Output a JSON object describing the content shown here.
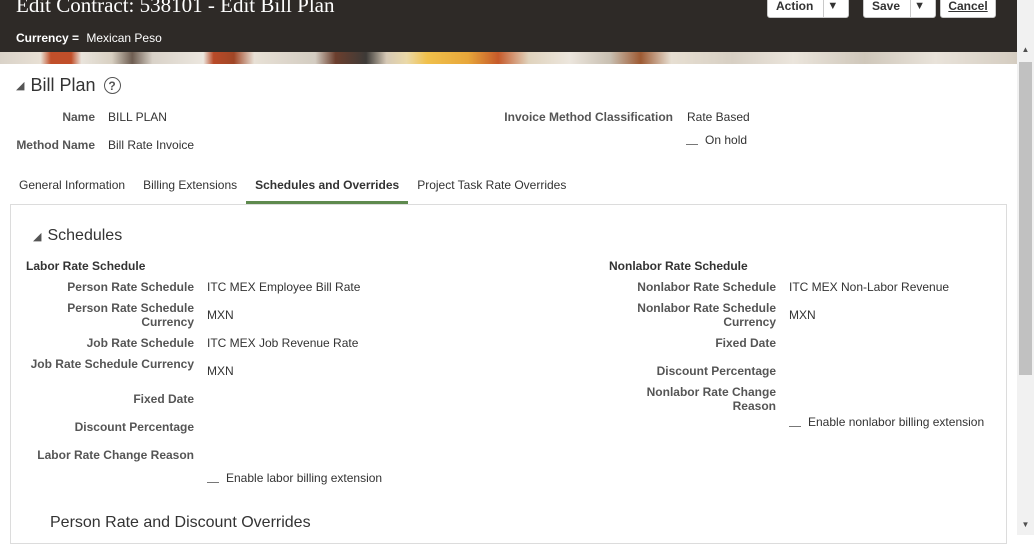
{
  "header": {
    "title": "Edit Contract: 538101 - Edit Bill Plan",
    "currency_label": "Currency =",
    "currency_value": "Mexican Peso",
    "action_label": "Action",
    "save_label": "Save",
    "cancel_label": "Cancel"
  },
  "bill_plan": {
    "section_title": "Bill Plan",
    "name_label": "Name",
    "name_value": "BILL PLAN",
    "method_label": "Method Name",
    "method_value": "Bill Rate Invoice",
    "classification_label": "Invoice Method Classification",
    "classification_value": "Rate Based",
    "on_hold_label": "On hold"
  },
  "tabs": [
    {
      "label": "General Information"
    },
    {
      "label": "Billing Extensions"
    },
    {
      "label": "Schedules and Overrides"
    },
    {
      "label": "Project Task Rate Overrides"
    }
  ],
  "schedules": {
    "section_title": "Schedules",
    "labor": {
      "group_label": "Labor Rate Schedule",
      "person_rate_schedule_label": "Person Rate Schedule",
      "person_rate_schedule_value": "ITC MEX Employee Bill Rate",
      "person_currency_label": "Person Rate Schedule Currency",
      "person_currency_value": "MXN",
      "job_rate_schedule_label": "Job Rate Schedule",
      "job_rate_schedule_value": "ITC MEX Job Revenue Rate",
      "job_currency_label": "Job Rate Schedule Currency",
      "job_currency_value": "MXN",
      "fixed_date_label": "Fixed Date",
      "discount_label": "Discount Percentage",
      "change_reason_label": "Labor Rate Change Reason",
      "enable_extension_label": "Enable labor billing extension"
    },
    "nonlabor": {
      "group_label": "Nonlabor Rate Schedule",
      "rate_schedule_label": "Nonlabor Rate Schedule",
      "rate_schedule_value": "ITC MEX Non-Labor Revenue",
      "currency_label": "Nonlabor Rate Schedule Currency",
      "currency_value": "MXN",
      "fixed_date_label": "Fixed Date",
      "discount_label": "Discount Percentage",
      "change_reason_label": "Nonlabor Rate Change Reason",
      "enable_extension_label": "Enable nonlabor billing extension"
    }
  },
  "overrides": {
    "section_title": "Person Rate and Discount Overrides"
  }
}
